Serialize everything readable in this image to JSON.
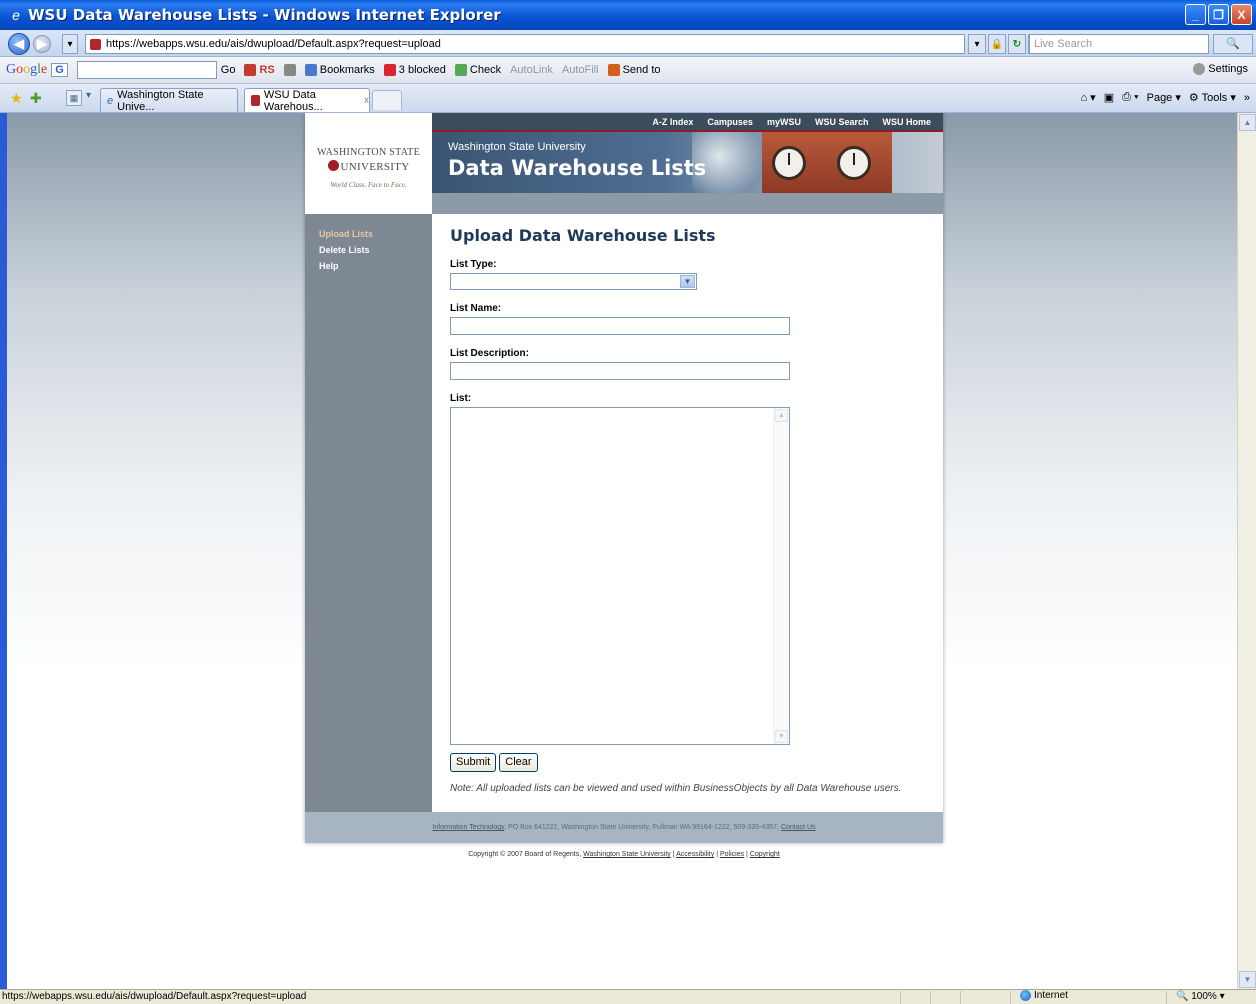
{
  "window": {
    "title": "WSU Data Warehouse Lists - Windows Internet Explorer",
    "min": "_",
    "max": "❐",
    "close": "X"
  },
  "address": {
    "url": "https://webapps.wsu.edu/ais/dwupload/Default.aspx?request=upload",
    "search_placeholder": "Live Search",
    "search_go": "🔍"
  },
  "google_toolbar": {
    "brand": [
      "G",
      "o",
      "o",
      "g",
      "l",
      "e"
    ],
    "g_label": "G",
    "items": [
      "Go",
      "RS",
      "Bookmarks",
      "3 blocked",
      "Check",
      "AutoLink",
      "AutoFill",
      "Send to"
    ],
    "settings": "Settings"
  },
  "tabs": [
    {
      "label": "Washington State Unive..."
    },
    {
      "label": "WSU Data Warehous...",
      "close": "x"
    }
  ],
  "command_bar": {
    "page": "Page",
    "tools": "Tools"
  },
  "site": {
    "topnav": [
      "A-Z Index",
      "Campuses",
      "myWSU",
      "WSU Search",
      "WSU Home"
    ],
    "logo_line1": "Washington State",
    "logo_line2": "UNIVERSITY",
    "logo_tagline": "World Class. Face to Face.",
    "banner_univ": "Washington State University",
    "banner_title": "Data Warehouse Lists",
    "leftnav": [
      "Upload Lists",
      "Delete Lists",
      "Help"
    ],
    "heading": "Upload Data Warehouse Lists",
    "form": {
      "list_type_label": "List Type:",
      "list_type_value": "",
      "list_name_label": "List Name:",
      "list_name_value": "",
      "list_desc_label": "List Description:",
      "list_desc_value": "",
      "list_label": "List:",
      "list_value": "",
      "submit": "Submit",
      "clear": "Clear"
    },
    "note": "Note: All uploaded lists can be viewed and used within BusinessObjects by all Data Warehouse users.",
    "footer_link": "Information Technology",
    "footer_text": ", PO Box 641222, Washington State University, Pullman WA 99164-1222, 509-335-4357,",
    "footer_contact": "Contact Us",
    "copyright_text": "Copyright © 2007 Board of Regents,",
    "copyright_links": [
      "Washington State University",
      "Accessibility",
      "Policies",
      "Copyright"
    ]
  },
  "status": {
    "text": "https://webapps.wsu.edu/ais/dwupload/Default.aspx?request=upload",
    "zone": "Internet",
    "zoom": "100%"
  }
}
